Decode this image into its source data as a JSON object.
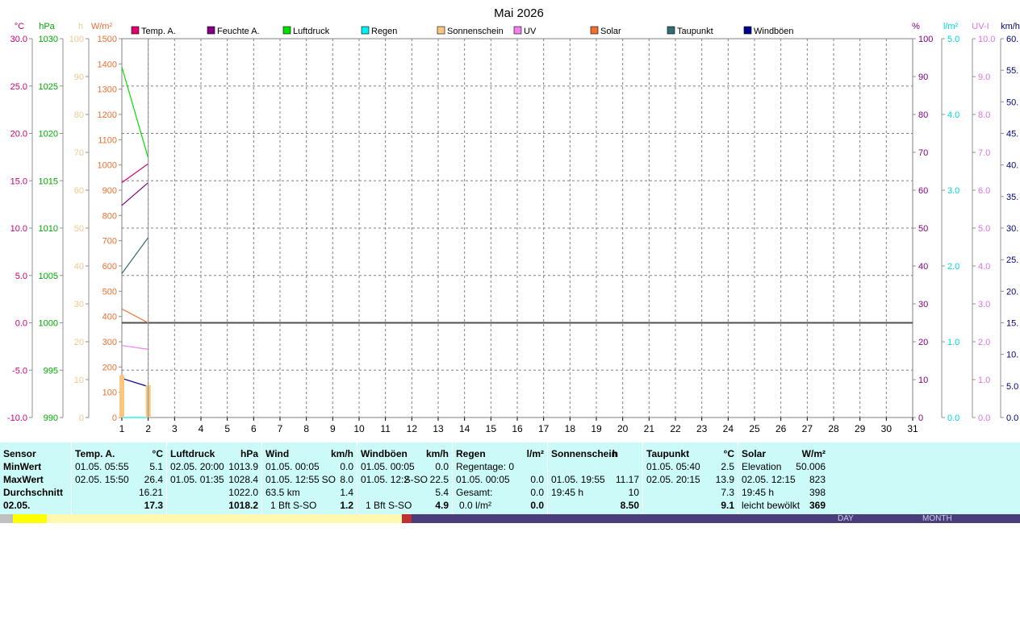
{
  "title": "Mai 2026",
  "left_axes": [
    {
      "unit": "°C",
      "color": "#d00070",
      "ticks": [
        "30.0",
        "25.0",
        "20.0",
        "15.0",
        "10.0",
        "5.0",
        "0.0",
        "-5.0",
        "-10.0"
      ]
    },
    {
      "unit": "hPa",
      "color": "#00aa00",
      "ticks": [
        "1030",
        "1025",
        "1020",
        "1015",
        "1010",
        "1005",
        "1000",
        "995",
        "990"
      ]
    },
    {
      "unit": "h",
      "color": "#f0c890",
      "ticks": [
        "100",
        "90",
        "80",
        "70",
        "60",
        "50",
        "40",
        "30",
        "20",
        "10",
        "0"
      ]
    },
    {
      "unit": "W/m²",
      "color": "#f07030",
      "ticks": [
        "1500",
        "1400",
        "1300",
        "1200",
        "1100",
        "1000",
        "900",
        "800",
        "700",
        "600",
        "500",
        "400",
        "300",
        "200",
        "100",
        "0"
      ]
    }
  ],
  "right_axes": [
    {
      "unit": "%",
      "color": "#800080",
      "ticks": [
        "100",
        "90",
        "80",
        "70",
        "60",
        "50",
        "40",
        "30",
        "20",
        "10",
        "0"
      ]
    },
    {
      "unit": "l/m²",
      "color": "#00d8d8",
      "ticks": [
        "5.0",
        "4.0",
        "3.0",
        "2.0",
        "1.0",
        "0.0"
      ]
    },
    {
      "unit": "UV-I",
      "color": "#e070e0",
      "ticks": [
        "10.0",
        "9.0",
        "8.0",
        "7.0",
        "6.0",
        "5.0",
        "4.0",
        "3.0",
        "2.0",
        "1.0",
        "0.0"
      ]
    },
    {
      "unit": "km/h",
      "color": "#000080",
      "ticks": [
        "60.",
        "55.",
        "50.",
        "45.",
        "40.",
        "35.",
        "30.",
        "25.",
        "20.",
        "15.",
        "10.",
        "5.0",
        "0.0"
      ]
    }
  ],
  "legend": [
    {
      "label": "Temp. A.",
      "color": "#e00070"
    },
    {
      "label": "Feuchte A.",
      "color": "#800080"
    },
    {
      "label": "Luftdruck",
      "color": "#00e000"
    },
    {
      "label": "Regen",
      "color": "#00f0f0"
    },
    {
      "label": "Sonnenschein",
      "color": "#f8c880"
    },
    {
      "label": "UV",
      "color": "#f080f0"
    },
    {
      "label": "Solar",
      "color": "#f07030"
    },
    {
      "label": "Taupunkt",
      "color": "#307070"
    },
    {
      "label": "Windböen",
      "color": "#000090"
    }
  ],
  "chart_data": {
    "type": "line",
    "title": "Mai 2026",
    "x": [
      1,
      2
    ],
    "xlim": [
      1,
      31
    ],
    "x_ticks": [
      "1",
      "2",
      "3",
      "4",
      "5",
      "6",
      "7",
      "8",
      "9",
      "10",
      "11",
      "12",
      "13",
      "14",
      "15",
      "16",
      "17",
      "18",
      "19",
      "20",
      "21",
      "22",
      "23",
      "24",
      "25",
      "26",
      "27",
      "28",
      "29",
      "30",
      "31"
    ],
    "series": [
      {
        "name": "Temp. A.",
        "unit": "°C",
        "ylim": [
          -10,
          30
        ],
        "values": [
          14.8,
          16.8
        ]
      },
      {
        "name": "Feuchte A.",
        "unit": "%",
        "ylim": [
          0,
          100
        ],
        "values": [
          56,
          62
        ]
      },
      {
        "name": "Luftdruck",
        "unit": "hPa",
        "ylim": [
          990,
          1030
        ],
        "values": [
          1027.0,
          1017.4
        ]
      },
      {
        "name": "Taupunkt",
        "unit": "°C",
        "ylim": [
          -10,
          30
        ],
        "values": [
          5.2,
          9.0
        ]
      },
      {
        "name": "Solar",
        "unit": "W/m²",
        "ylim": [
          0,
          1500
        ],
        "values": [
          430,
          375
        ]
      },
      {
        "name": "UV",
        "unit": "UV-I",
        "ylim": [
          0,
          10
        ],
        "values": [
          1.9,
          1.8
        ]
      },
      {
        "name": "Windböen",
        "unit": "km/h",
        "ylim": [
          0,
          60
        ],
        "values": [
          6.2,
          4.9
        ]
      },
      {
        "name": "Regen",
        "unit": "l/m²",
        "ylim": [
          0,
          5
        ],
        "values": [
          0,
          0
        ]
      },
      {
        "name": "Sonnenschein",
        "unit": "h",
        "ylim": [
          0,
          100
        ],
        "type": "bar",
        "values": [
          11.17,
          8.5
        ]
      }
    ],
    "zero_line_celsius": 0,
    "grid": true
  },
  "table": {
    "sensor": {
      "header": "Sensor",
      "min": "MinWert",
      "max": "MaxWert",
      "avg": "Durchschnitt",
      "day": "02.05."
    },
    "temp": {
      "header": "Temp. A.",
      "unit": "°C",
      "min_date": "01.05.  05:55",
      "min_val": "5.1",
      "max_date": "02.05.  15:50",
      "max_val": "26.4",
      "avg_val": "16.21",
      "day_val": "17.3"
    },
    "pressure": {
      "header": "Luftdruck",
      "unit": "hPa",
      "min_date": "02.05.  20:00",
      "min_val": "1013.9",
      "max_date": "01.05.  01:35",
      "max_val": "1028.4",
      "avg_val": "1022.0",
      "day_val": "1018.2"
    },
    "wind": {
      "header": "Wind",
      "unit": "km/h",
      "min_date": "01.05.  00:05",
      "min_val": "0.0",
      "max_date": "01.05.  12:55",
      "max_dir": "SO",
      "max_val": "8.0",
      "avg_text": "63.5 km",
      "avg_val": "1.4",
      "day_text": "1 Bft S-SO",
      "day_val": "1.2"
    },
    "gusts": {
      "header": "Windböen",
      "unit": "km/h",
      "min_date": "01.05.  00:05",
      "min_val": "0.0",
      "max_date": "01.05.  12:2",
      "max_dir": "S-SO",
      "max_val": "22.5",
      "avg_val": "5.4",
      "day_text": "1 Bft S-SO",
      "day_val": "4.9"
    },
    "rain": {
      "header": "Regen",
      "unit": "l/m²",
      "min_text": "Regentage: 0",
      "max_date": "01.05.  00:05",
      "max_val": "0.0",
      "avg_text": "Gesamt:",
      "avg_val": "0.0",
      "day_text": "0.0 l/m²",
      "day_val": "0.0"
    },
    "sunshine": {
      "header": "Sonnenschein",
      "unit": "h",
      "max_date": "01.05.  19:55",
      "max_val": "11.17",
      "avg_text": "19:45 h",
      "avg_val": "10",
      "day_val": "8.50"
    },
    "dewpoint": {
      "header": "Taupunkt",
      "unit": "°C",
      "min_date": "01.05.  05:40",
      "min_val": "2.5",
      "max_date": "02.05.  20:15",
      "max_val": "13.9",
      "avg_val": "7.3",
      "day_val": "9.1"
    },
    "solar": {
      "header": "Solar",
      "unit": "W/m²",
      "min_text": "Elevation",
      "min_val": "50.006",
      "max_date": "02.05.  12:15",
      "max_val": "823",
      "avg_text": "19:45 h",
      "avg_val": "398",
      "day_text": "leicht bewölkt",
      "day_val": "369"
    }
  },
  "strip_labels": [
    "DAY",
    "MONTH"
  ]
}
